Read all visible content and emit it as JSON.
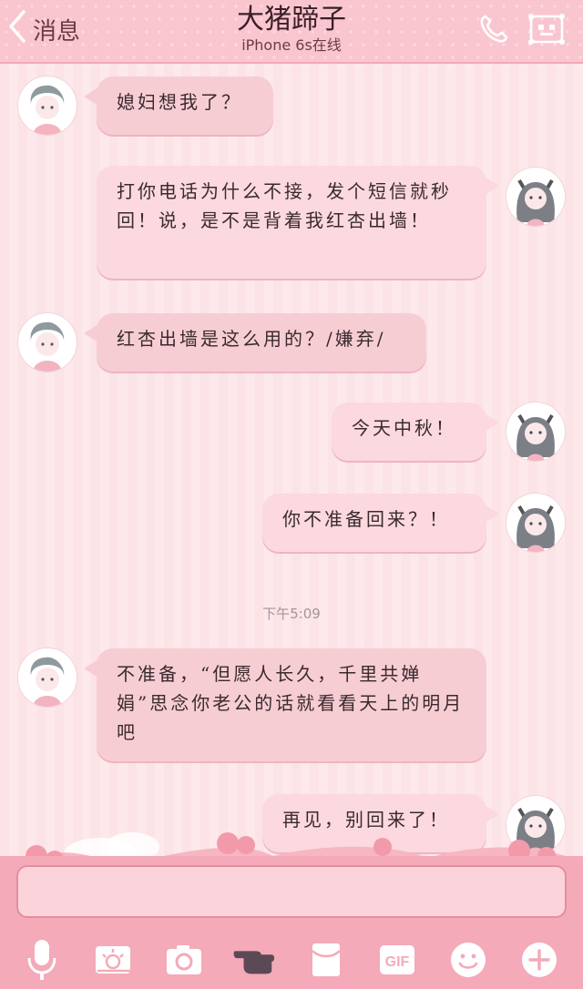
{
  "header": {
    "back_label": "消息",
    "title": "大猪蹄子",
    "subtitle": "iPhone 6s在线"
  },
  "messages": [
    {
      "side": "left",
      "text": "媳妇想我了？"
    },
    {
      "side": "right",
      "text": "打你电话为什么不接，发个短信就秒回！说，是不是背着我红杏出墙！"
    },
    {
      "side": "left",
      "text": "红杏出墙是这么用的？/嫌弃/"
    },
    {
      "side": "right",
      "text": "今天中秋！"
    },
    {
      "side": "right",
      "text": "你不准备回来？！"
    },
    {
      "side": "left",
      "text": "不准备，“但愿人长久，千里共婵娟”思念你老公的话就看看天上的明月吧"
    },
    {
      "side": "right",
      "text": "再见，别回来了！"
    }
  ],
  "timestamp": "下午5:09",
  "input": {
    "value": "",
    "placeholder": ""
  },
  "toolbar": {
    "gif_label": "GIF",
    "icons": [
      "microphone-icon",
      "image-icon",
      "camera-icon",
      "hand-icon",
      "envelope-icon",
      "gif-icon",
      "emoji-icon",
      "plus-icon"
    ]
  },
  "colors": {
    "header": "#f9c6cf",
    "bubble_left": "#f7cdd4",
    "bubble_right": "#fbd9de",
    "composer": "#f4aab8"
  }
}
